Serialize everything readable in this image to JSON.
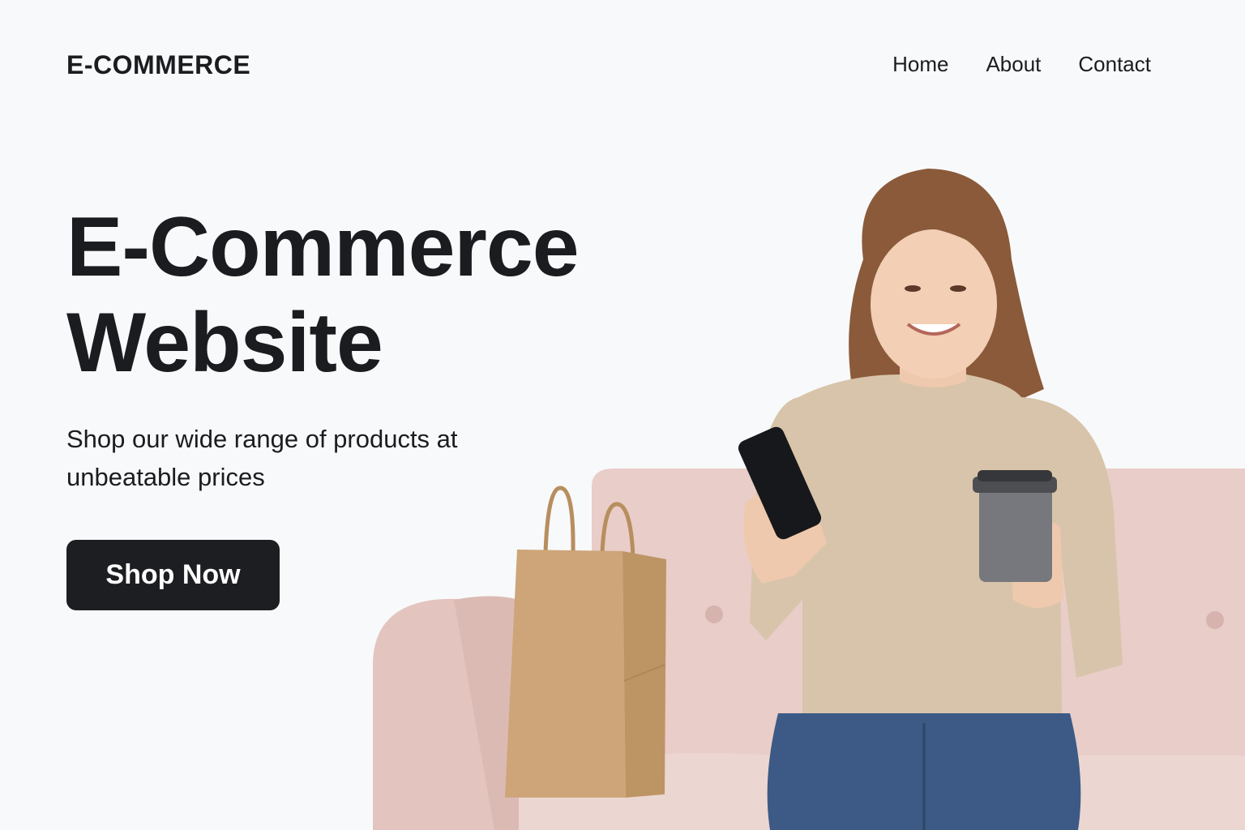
{
  "header": {
    "logo": "E-COMMERCE",
    "nav": [
      "Home",
      "About",
      "Contact"
    ]
  },
  "hero": {
    "title_line1": "E-Commerce",
    "title_line2": "Website",
    "subtitle": "Shop our wide range of products at unbeatable prices",
    "cta_label": "Shop Now"
  },
  "colors": {
    "background": "#f8f9fa",
    "text": "#1b1c20",
    "button": "#1d1e22",
    "sofa": "#e8cdc8",
    "sweater": "#d8c4aa",
    "bag": "#cda578",
    "jeans": "#3c5a85"
  }
}
